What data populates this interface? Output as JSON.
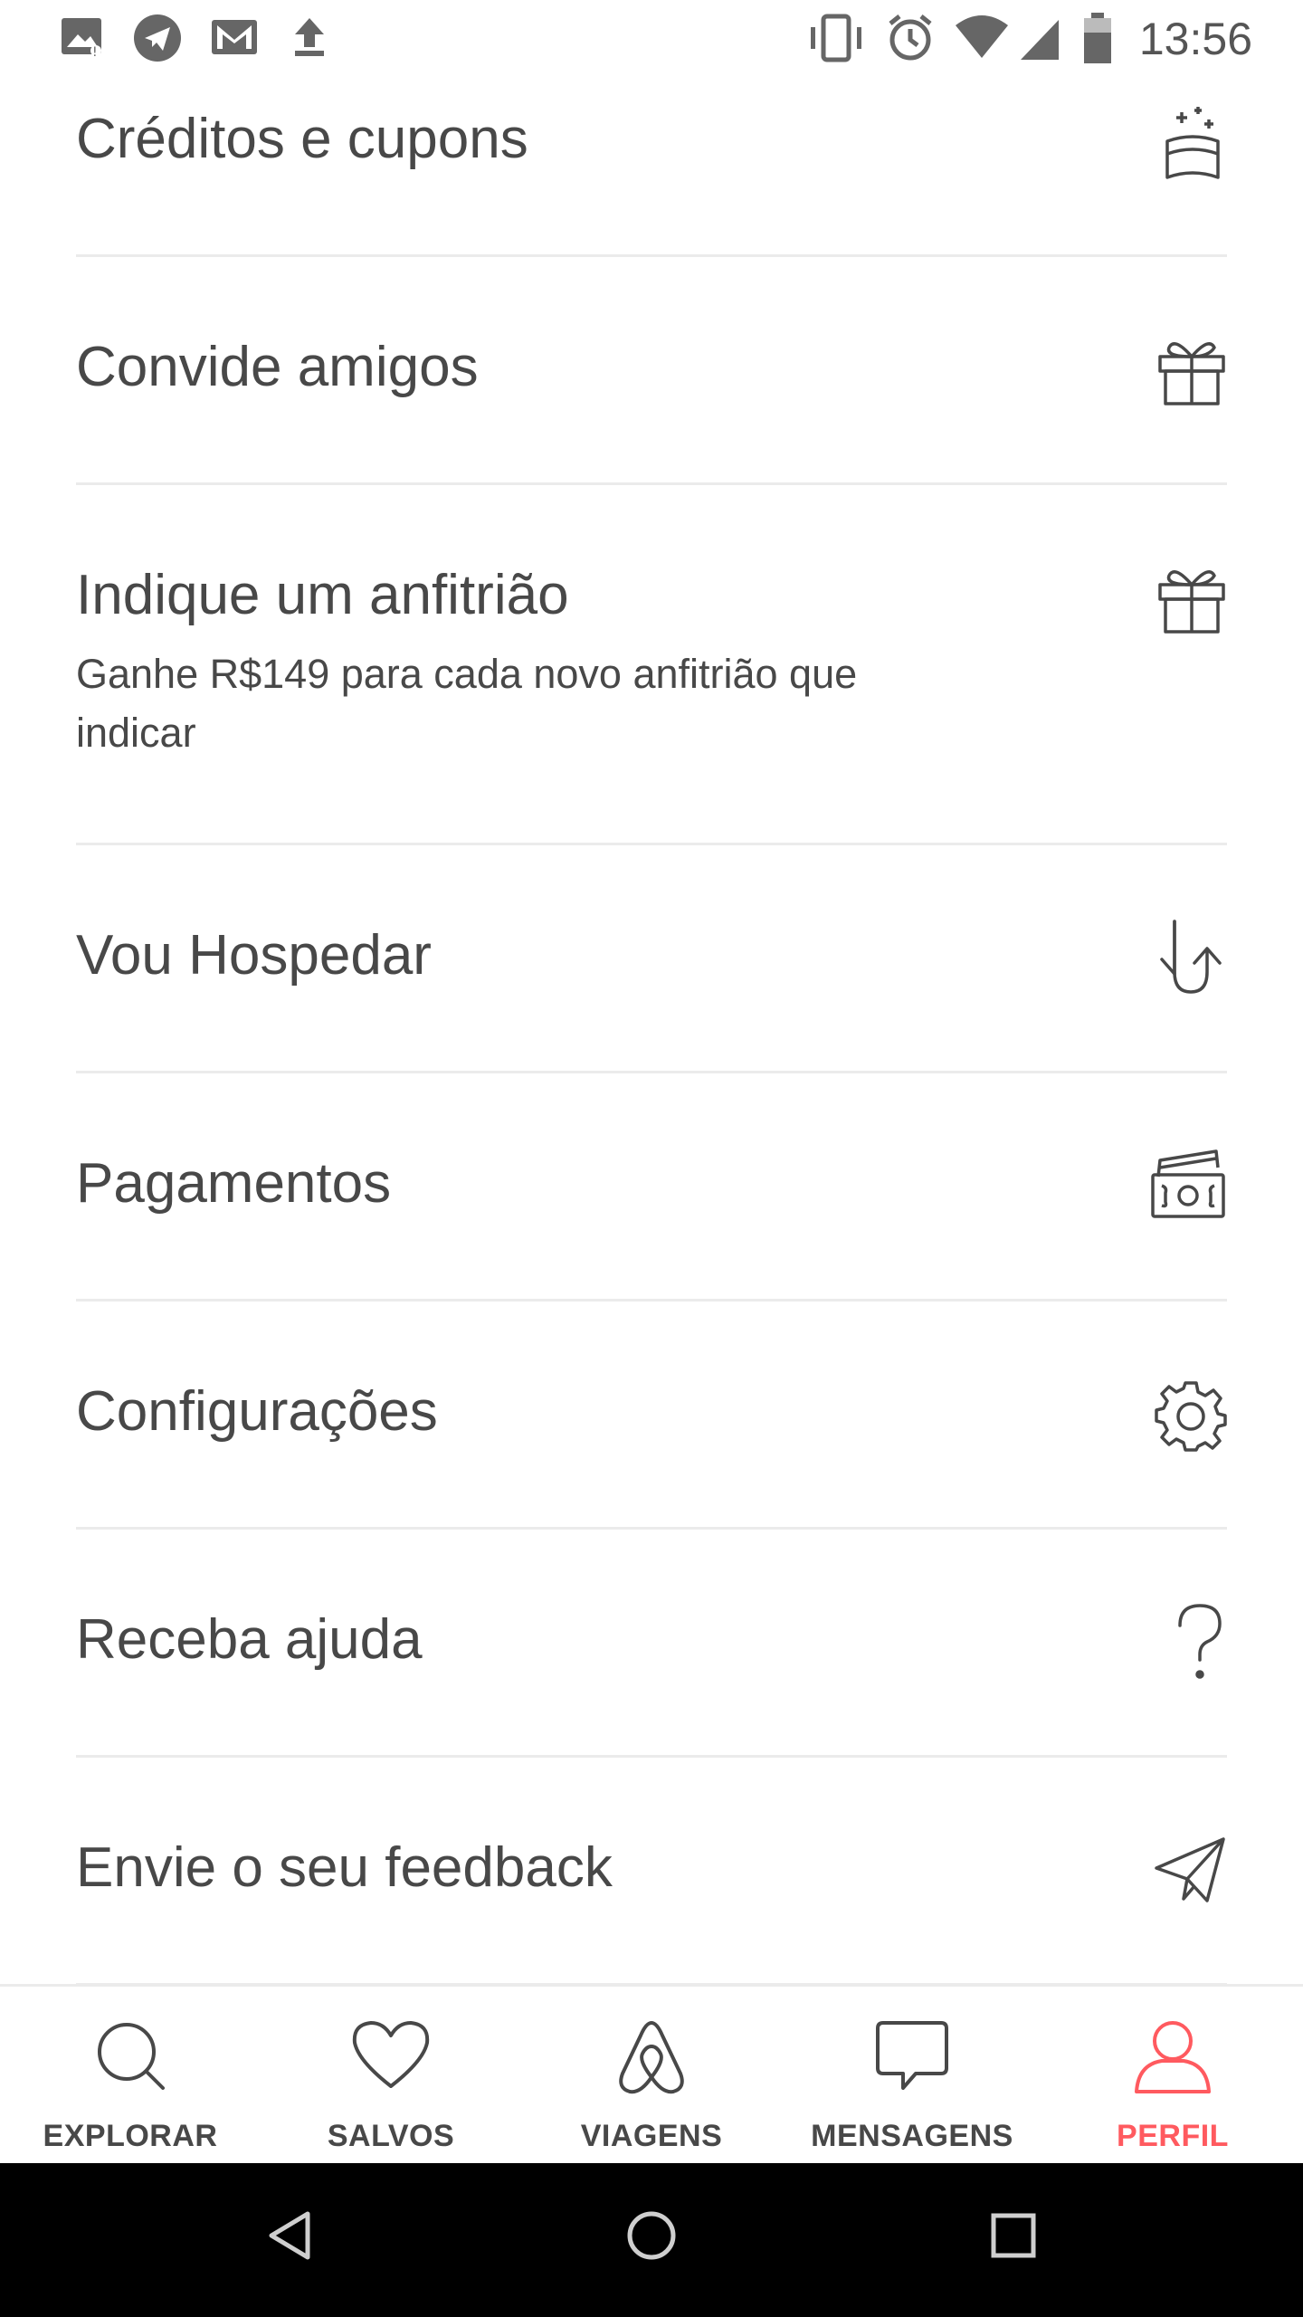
{
  "status_bar": {
    "time": "13:56",
    "left_icons": [
      "image-icon",
      "telegram-icon",
      "gmail-icon",
      "upload-icon"
    ],
    "right_icons": [
      "vibrate-icon",
      "alarm-icon",
      "wifi-icon",
      "signal-icon",
      "battery-icon"
    ]
  },
  "menu": {
    "items": [
      {
        "title": "Créditos e cupons",
        "subtitle": "",
        "icon": "credits-coupons-icon"
      },
      {
        "title": "Convide amigos",
        "subtitle": "",
        "icon": "gift-icon"
      },
      {
        "title": "Indique um anfitrião",
        "subtitle": "Ganhe R$149 para cada novo anfitrião que indicar",
        "icon": "gift-icon"
      },
      {
        "title": "Vou Hospedar",
        "subtitle": "",
        "icon": "host-switch-icon"
      },
      {
        "title": "Pagamentos",
        "subtitle": "",
        "icon": "payments-icon"
      },
      {
        "title": "Configurações",
        "subtitle": "",
        "icon": "gear-icon"
      },
      {
        "title": "Receba ajuda",
        "subtitle": "",
        "icon": "help-icon"
      },
      {
        "title": "Envie o seu feedback",
        "subtitle": "",
        "icon": "paper-plane-icon"
      }
    ]
  },
  "bottom_nav": {
    "active_color": "#FF5A5F",
    "tabs": [
      {
        "label": "EXPLORAR",
        "icon": "search-icon",
        "active": false
      },
      {
        "label": "SALVOS",
        "icon": "heart-icon",
        "active": false
      },
      {
        "label": "VIAGENS",
        "icon": "airbnb-logo-icon",
        "active": false
      },
      {
        "label": "MENSAGENS",
        "icon": "chat-icon",
        "active": false
      },
      {
        "label": "PERFIL",
        "icon": "profile-icon",
        "active": true
      }
    ]
  },
  "system_nav": {
    "buttons": [
      "back-icon",
      "home-icon",
      "recents-icon"
    ]
  }
}
